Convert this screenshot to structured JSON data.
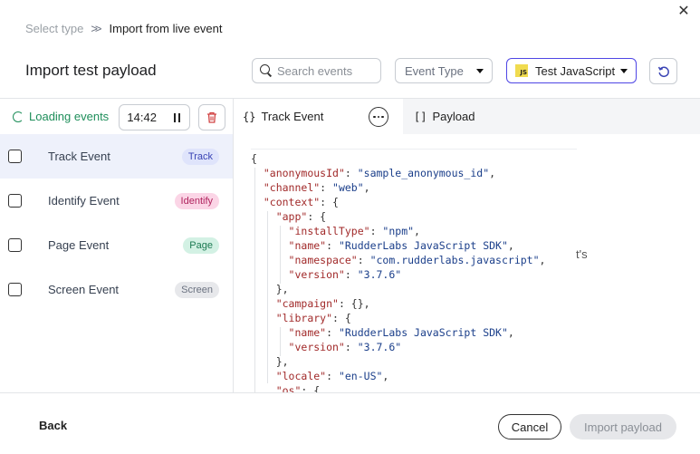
{
  "breadcrumb": {
    "step1": "Select type",
    "sep": ">>",
    "step2": "Import from live event"
  },
  "title": "Import test payload",
  "search": {
    "placeholder": "Search events"
  },
  "event_type": {
    "label": "Event Type"
  },
  "source": {
    "badge": "JS",
    "label": "Test JavaScript"
  },
  "status": {
    "loading_label": "Loading events",
    "timer": "14:42"
  },
  "events": [
    {
      "name": "Track Event",
      "badge": "Track",
      "badge_bg": "#dfe4fb",
      "badge_fg": "#3b45b5",
      "selected": true
    },
    {
      "name": "Identify Event",
      "badge": "Identify",
      "badge_bg": "#fbd5e6",
      "badge_fg": "#b0245e",
      "selected": false
    },
    {
      "name": "Page Event",
      "badge": "Page",
      "badge_bg": "#d3f1e4",
      "badge_fg": "#1c7a52",
      "selected": false
    },
    {
      "name": "Screen Event",
      "badge": "Screen",
      "badge_bg": "#e7e8eb",
      "badge_fg": "#6b7280",
      "selected": false
    }
  ],
  "tabs": {
    "track": "Track Event",
    "payload": "Payload",
    "track_icon": "{}",
    "payload_icon": "[]"
  },
  "code_lines": [
    [
      {
        "t": "p",
        "v": "{"
      }
    ],
    [
      {
        "t": "p",
        "v": "  "
      },
      {
        "t": "k",
        "v": "\"anonymousId\""
      },
      {
        "t": "p",
        "v": ": "
      },
      {
        "t": "s",
        "v": "\"sample_anonymous_id\""
      },
      {
        "t": "p",
        "v": ","
      }
    ],
    [
      {
        "t": "p",
        "v": "  "
      },
      {
        "t": "k",
        "v": "\"channel\""
      },
      {
        "t": "p",
        "v": ": "
      },
      {
        "t": "s",
        "v": "\"web\""
      },
      {
        "t": "p",
        "v": ","
      }
    ],
    [
      {
        "t": "p",
        "v": "  "
      },
      {
        "t": "k",
        "v": "\"context\""
      },
      {
        "t": "p",
        "v": ": {"
      }
    ],
    [
      {
        "t": "p",
        "v": "    "
      },
      {
        "t": "k",
        "v": "\"app\""
      },
      {
        "t": "p",
        "v": ": {"
      }
    ],
    [
      {
        "t": "p",
        "v": "      "
      },
      {
        "t": "k",
        "v": "\"installType\""
      },
      {
        "t": "p",
        "v": ": "
      },
      {
        "t": "s",
        "v": "\"npm\""
      },
      {
        "t": "p",
        "v": ","
      }
    ],
    [
      {
        "t": "p",
        "v": "      "
      },
      {
        "t": "k",
        "v": "\"name\""
      },
      {
        "t": "p",
        "v": ": "
      },
      {
        "t": "s",
        "v": "\"RudderLabs JavaScript SDK\""
      },
      {
        "t": "p",
        "v": ","
      }
    ],
    [
      {
        "t": "p",
        "v": "      "
      },
      {
        "t": "k",
        "v": "\"namespace\""
      },
      {
        "t": "p",
        "v": ": "
      },
      {
        "t": "s",
        "v": "\"com.rudderlabs.javascript\""
      },
      {
        "t": "p",
        "v": ","
      }
    ],
    [
      {
        "t": "p",
        "v": "      "
      },
      {
        "t": "k",
        "v": "\"version\""
      },
      {
        "t": "p",
        "v": ": "
      },
      {
        "t": "s",
        "v": "\"3.7.6\""
      }
    ],
    [
      {
        "t": "p",
        "v": "    },"
      }
    ],
    [
      {
        "t": "p",
        "v": "    "
      },
      {
        "t": "k",
        "v": "\"campaign\""
      },
      {
        "t": "p",
        "v": ": {},"
      }
    ],
    [
      {
        "t": "p",
        "v": "    "
      },
      {
        "t": "k",
        "v": "\"library\""
      },
      {
        "t": "p",
        "v": ": {"
      }
    ],
    [
      {
        "t": "p",
        "v": "      "
      },
      {
        "t": "k",
        "v": "\"name\""
      },
      {
        "t": "p",
        "v": ": "
      },
      {
        "t": "s",
        "v": "\"RudderLabs JavaScript SDK\""
      },
      {
        "t": "p",
        "v": ","
      }
    ],
    [
      {
        "t": "p",
        "v": "      "
      },
      {
        "t": "k",
        "v": "\"version\""
      },
      {
        "t": "p",
        "v": ": "
      },
      {
        "t": "s",
        "v": "\"3.7.6\""
      }
    ],
    [
      {
        "t": "p",
        "v": "    },"
      }
    ],
    [
      {
        "t": "p",
        "v": "    "
      },
      {
        "t": "k",
        "v": "\"locale\""
      },
      {
        "t": "p",
        "v": ": "
      },
      {
        "t": "s",
        "v": "\"en-US\""
      },
      {
        "t": "p",
        "v": ","
      }
    ],
    [
      {
        "t": "p",
        "v": "    "
      },
      {
        "t": "k",
        "v": "\"os\""
      },
      {
        "t": "p",
        "v": ": {"
      }
    ]
  ],
  "partial_text": "t's",
  "footer": {
    "back": "Back",
    "cancel": "Cancel",
    "import": "Import payload"
  },
  "icons": {
    "close": "close-icon",
    "search": "search-icon",
    "refresh": "refresh-icon",
    "pause": "pause-icon",
    "trash": "trash-icon",
    "more": "more-icon"
  },
  "colors": {
    "accent": "#4f46e5",
    "loading": "#1e8e5a",
    "danger": "#d14343"
  }
}
